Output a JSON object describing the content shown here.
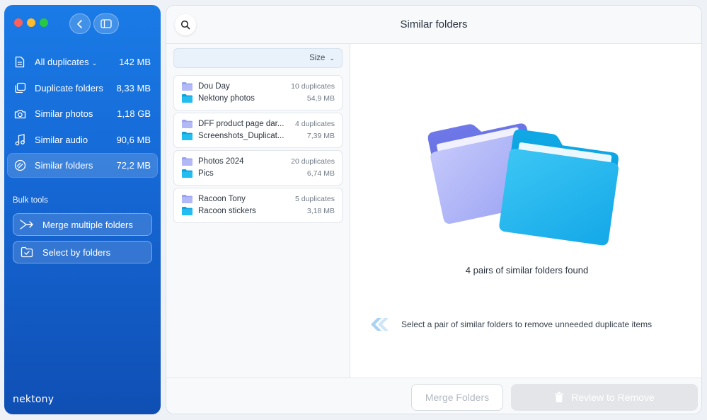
{
  "window": {
    "title": "Similar folders"
  },
  "sidebar": {
    "items": [
      {
        "label": "All duplicates",
        "size": "142 MB",
        "icon": "document-icon",
        "has_dropdown": true
      },
      {
        "label": "Duplicate folders",
        "size": "8,33 MB",
        "icon": "duplicate-folders-icon"
      },
      {
        "label": "Similar photos",
        "size": "1,18 GB",
        "icon": "camera-icon"
      },
      {
        "label": "Similar audio",
        "size": "90,6 MB",
        "icon": "music-note-icon"
      },
      {
        "label": "Similar folders",
        "size": "72,2 MB",
        "icon": "similar-folders-icon",
        "active": true
      }
    ],
    "bulk_title": "Bulk tools",
    "bulk_tools": [
      {
        "label": "Merge multiple folders",
        "icon": "merge-arrow-icon"
      },
      {
        "label": "Select by folders",
        "icon": "folder-check-icon"
      }
    ],
    "logo": "nektony"
  },
  "list": {
    "sort_label": "Size",
    "pairs": [
      {
        "folder_a": "Dou Day",
        "folder_b": "Nektony photos",
        "duplicates": "10 duplicates",
        "size": "54,9 MB"
      },
      {
        "folder_a": "DFF product page dar...",
        "folder_b": "Screenshots_Duplicat...",
        "duplicates": "4 duplicates",
        "size": "7,39 MB"
      },
      {
        "folder_a": "Photos 2024",
        "folder_b": "Pics",
        "duplicates": "20 duplicates",
        "size": "6,74 MB"
      },
      {
        "folder_a": "Racoon Tony",
        "folder_b": "Racoon stickers",
        "duplicates": "5 duplicates",
        "size": "3,18 MB"
      }
    ]
  },
  "detail": {
    "found_text": "4 pairs of similar folders found",
    "hint_text": "Select a pair of similar folders to remove unneeded duplicate items"
  },
  "footer": {
    "merge_label": "Merge Folders",
    "review_label": "Review to Remove"
  },
  "colors": {
    "sidebar_top": "#1a7be6",
    "sidebar_bottom": "#0f4fb4",
    "folder_purple": "#9aa3f2",
    "folder_blue": "#1ab3ea"
  }
}
